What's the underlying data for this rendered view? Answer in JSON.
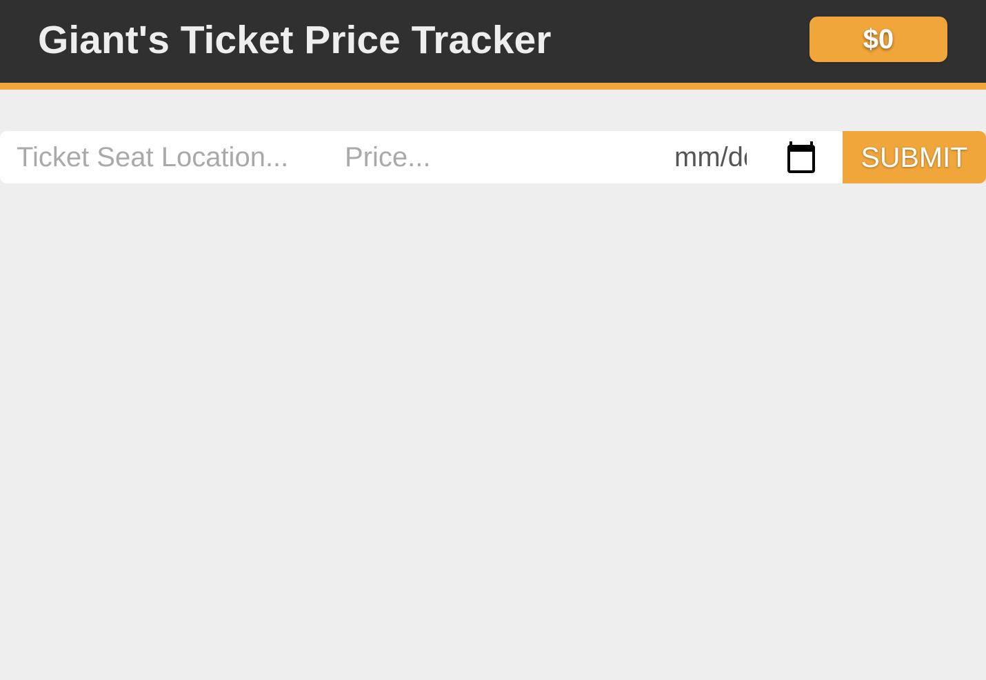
{
  "header": {
    "title": "Giant's Ticket Price Tracker",
    "total": "$0"
  },
  "form": {
    "seat_placeholder": "Ticket Seat Location...",
    "price_placeholder": "Price...",
    "date_value": "mm/dd/yyyy",
    "date_icon": "calendar-icon",
    "submit_label": "SUBMIT"
  },
  "colors": {
    "header_bg": "#303030",
    "accent": "#f0a63a",
    "page_bg": "#eeeeee",
    "title_text": "#eeeeee"
  }
}
